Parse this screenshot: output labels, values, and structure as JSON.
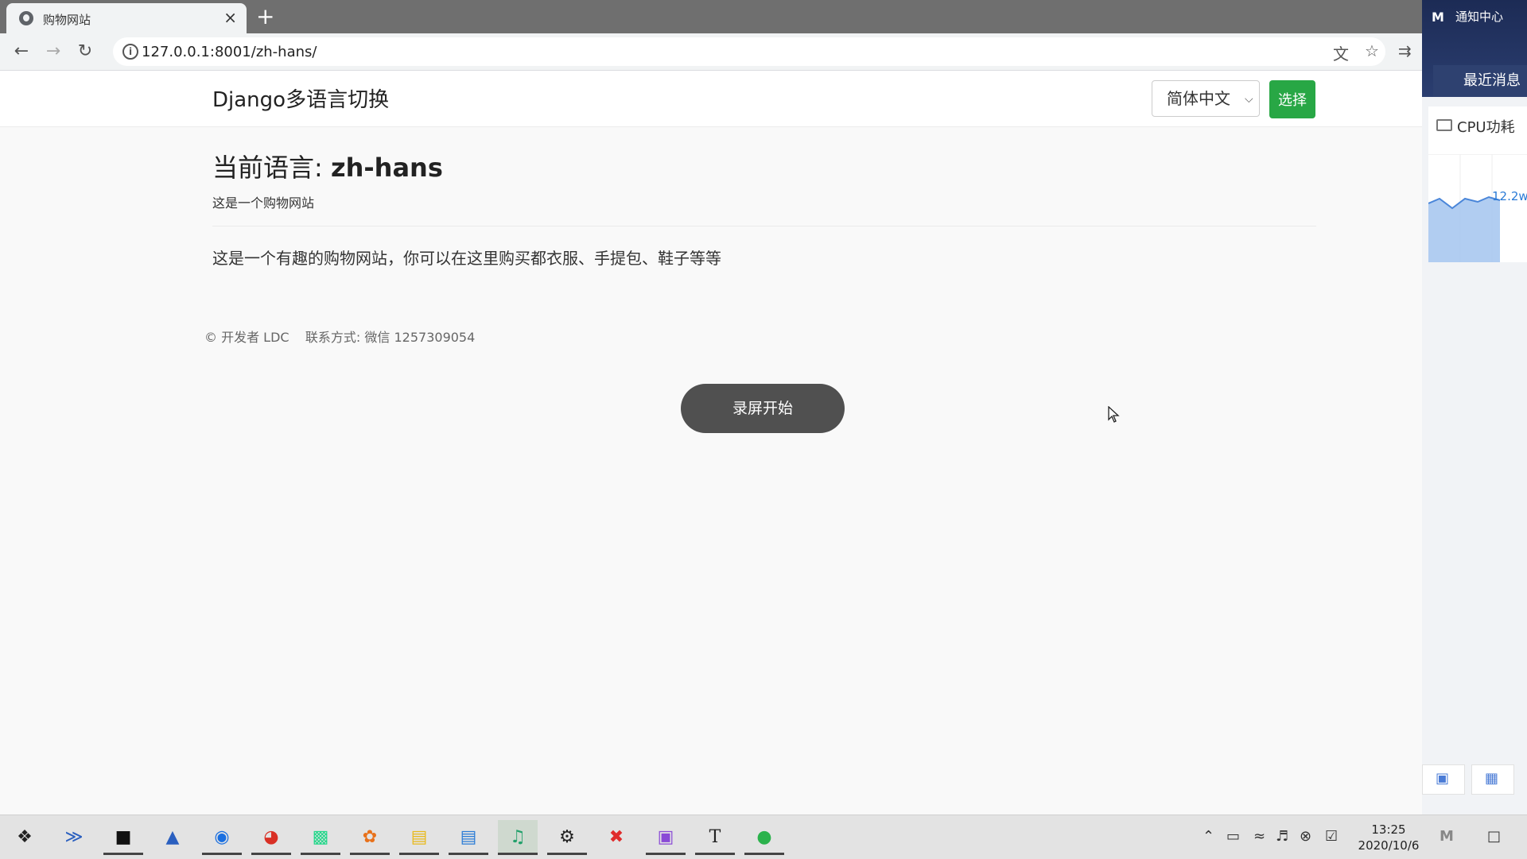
{
  "browser": {
    "tab_title": "购物网站",
    "tab_close": "×",
    "new_tab": "+",
    "url": "127.0.0.1:8001/zh-hans/"
  },
  "header": {
    "site_title": "Django多语言切换",
    "language_selected": "简体中文",
    "choose_button": "选择"
  },
  "main": {
    "heading_prefix": "当前语言: ",
    "current_language": "zh-hans",
    "subtitle": "这是一个购物网站",
    "description": "这是一个有趣的购物网站，你可以在这里购买都衣服、手提包、鞋子等等"
  },
  "footer": {
    "text": "© 开发者 LDC    联系方式: 微信 1257309054"
  },
  "overlay": {
    "record_button": "录屏开始"
  },
  "side_panel": {
    "logo": "M",
    "title": "通知中心",
    "recent_messages": "最近消息",
    "cpu_label": "CPU功耗",
    "cpu_value": "12.2w"
  },
  "taskbar": {
    "time": "13:25",
    "date": "2020/10/6",
    "apps": [
      {
        "name": "start",
        "icon": "windows-icon"
      },
      {
        "name": "powershell",
        "icon": "powershell-icon"
      },
      {
        "name": "terminal",
        "icon": "terminal-icon"
      },
      {
        "name": "network",
        "icon": "network-icon"
      },
      {
        "name": "maps",
        "icon": "maps-icon"
      },
      {
        "name": "chrome",
        "icon": "chrome-icon"
      },
      {
        "name": "pycharm",
        "icon": "pycharm-icon"
      },
      {
        "name": "browser",
        "icon": "browser-icon"
      },
      {
        "name": "file-explorer",
        "icon": "folder-icon"
      },
      {
        "name": "news",
        "icon": "news-icon"
      },
      {
        "name": "music",
        "icon": "music-icon"
      },
      {
        "name": "settings",
        "icon": "gear-icon"
      },
      {
        "name": "xmind",
        "icon": "xmind-icon"
      },
      {
        "name": "app",
        "icon": "app-icon"
      },
      {
        "name": "typora",
        "icon": "typora-icon"
      },
      {
        "name": "wechat",
        "icon": "wechat-icon"
      }
    ]
  },
  "colors": {
    "accent_green": "#28a745",
    "record_button": "#505050",
    "side_header": "#1c2b55"
  }
}
